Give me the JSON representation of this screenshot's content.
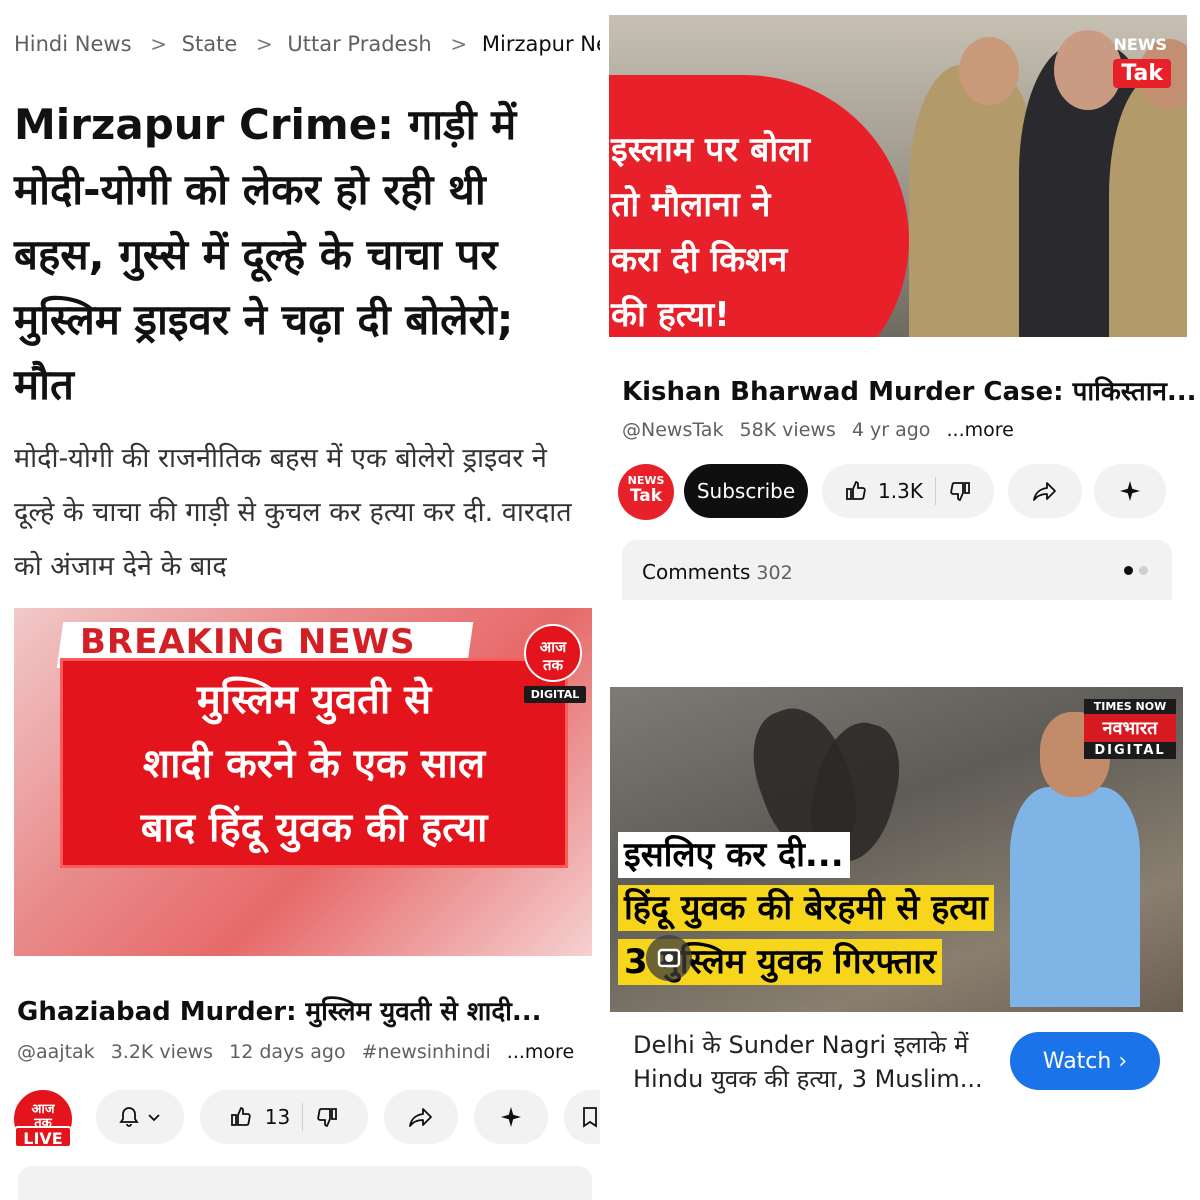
{
  "article": {
    "breadcrumb": [
      "Hindi News",
      "State",
      "Uttar Pradesh",
      "Mirzapur News"
    ],
    "headline": "Mirzapur Crime: गाड़ी में मोदी-योगी को लेकर हो रही थी बहस, गुस्से में दूल्हे के चाचा पर मुस्लिम ड्राइवर ने चढ़ा दी बोलेरो; मौत",
    "summary": "मोदी-योगी की राजनीतिक बहस में एक बोलेरो ड्राइवर ने दूल्हे के चाचा की गाड़ी से कुचल कर हत्या कर दी. वारदात को अंजाम देने के बाद"
  },
  "newstak": {
    "thumbnail_text": [
      "इस्लाम पर बोला",
      "तो मौलाना ने",
      "करा दी किशन",
      "की हत्या!"
    ],
    "logo_top": "NEWS",
    "logo_bottom": "Tak",
    "title": "Kishan Bharwad Murder Case: पाकिस्तान...",
    "channel": "@NewsTak",
    "views": "58K views",
    "age": "4 yr ago",
    "more": "...more",
    "avatar_top": "NEWS",
    "avatar_bottom": "Tak",
    "subscribe_label": "Subscribe",
    "likes": "1.3K",
    "comments_label": "Comments",
    "comments_count": "302"
  },
  "aajtak": {
    "breaking": "BREAKING NEWS",
    "thumbnail_text": [
      "मुस्लिम युवती से",
      "शादी करने के एक साल",
      "बाद हिंदू युवक की हत्या"
    ],
    "logo_top": "आज",
    "logo_bottom": "तक",
    "logo_digital": "DIGITAL",
    "title": "Ghaziabad Murder: मुस्लिम युवती से शादी...",
    "channel": "@aajtak",
    "views": "3.2K views",
    "age": "12 days ago",
    "hashtag": "#newsinhindi",
    "more": "...more",
    "avatar_top": "आज",
    "avatar_bottom": "तक",
    "live_label": "LIVE",
    "likes": "13"
  },
  "timesnow": {
    "logo_top": "TIMES NOW",
    "logo_mid": "नवभारत",
    "logo_bot": "DIGITAL",
    "caption1": "इसलिए कर दी...",
    "caption2": "हिंदू युवक की बेरहमी से हत्या",
    "caption3": "3 मुस्लिम युवक गिरफ्तार",
    "description": "Delhi के Sunder Nagri इलाके में Hindu युवक की हत्या, 3 Muslim...",
    "watch_label": "Watch ›"
  },
  "colors": {
    "newstak_red": "#e8202a",
    "aajtak_red": "#e3141c",
    "times_yellow": "#f7d51b",
    "watch_blue": "#1a73e8"
  }
}
